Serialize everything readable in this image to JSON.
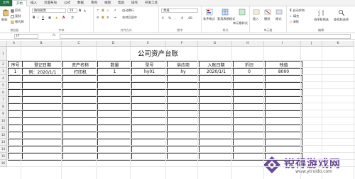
{
  "tabs": [
    "文件",
    "开始",
    "插入",
    "页面布局",
    "公式",
    "数据",
    "审阅",
    "视图",
    "帮助",
    "操作",
    "开发工具"
  ],
  "active_tab": "开始",
  "ribbon": {
    "clipboard": {
      "paste": "粘贴",
      "cut": "剪切",
      "copy": "复制",
      "format_painter": "格式刷",
      "label": "剪贴板"
    },
    "font": {
      "name": "微软雅黑",
      "size": "16",
      "label": "字体"
    },
    "alignment": {
      "wrap": "自动换行",
      "merge": "合并后居中",
      "label": "对齐方式"
    },
    "number": {
      "format": "常规",
      "label": "数字"
    },
    "styles": {
      "conditional": "条件格式",
      "table": "套用表格格式",
      "cell_styles": "单元格样式",
      "label": "样式"
    },
    "cells": {
      "insert": "插入",
      "delete": "删除",
      "format": "格式",
      "label": "单元格"
    },
    "editing": {
      "autosum": "自动求和",
      "fill": "填充",
      "clear": "清除",
      "sort": "排序和筛选",
      "find": "查找和选择",
      "label": "编辑"
    }
  },
  "formula_bar": {
    "name_box": "I7",
    "fx": "fx",
    "value": ""
  },
  "grid": {
    "columns": [
      "A",
      "B",
      "C",
      "D",
      "E",
      "F",
      "G",
      "H",
      "I",
      "J",
      "K"
    ],
    "rows": [
      "1",
      "2",
      "3",
      "4",
      "5",
      "6",
      "7",
      "8",
      "9",
      "10",
      "11",
      "12",
      "13",
      "14",
      "15",
      "16"
    ]
  },
  "sheet": {
    "title": "公司资产台账",
    "headers": [
      "序号",
      "登记日期",
      "资产名称",
      "数量",
      "型号",
      "供应商",
      "入账日期",
      "折旧",
      "残值"
    ],
    "rows": [
      [
        "1",
        "例：2020/1/1",
        "打印机",
        "1",
        "hy01",
        "hy",
        "2020/1/1",
        "0",
        "8000"
      ]
    ],
    "empty_rows": 12
  },
  "watermark": {
    "name": "锐得游戏网",
    "url": "www.ytruido.com"
  },
  "colors": {
    "excel_green": "#217346",
    "watermark_purple": "#6b4b97"
  }
}
